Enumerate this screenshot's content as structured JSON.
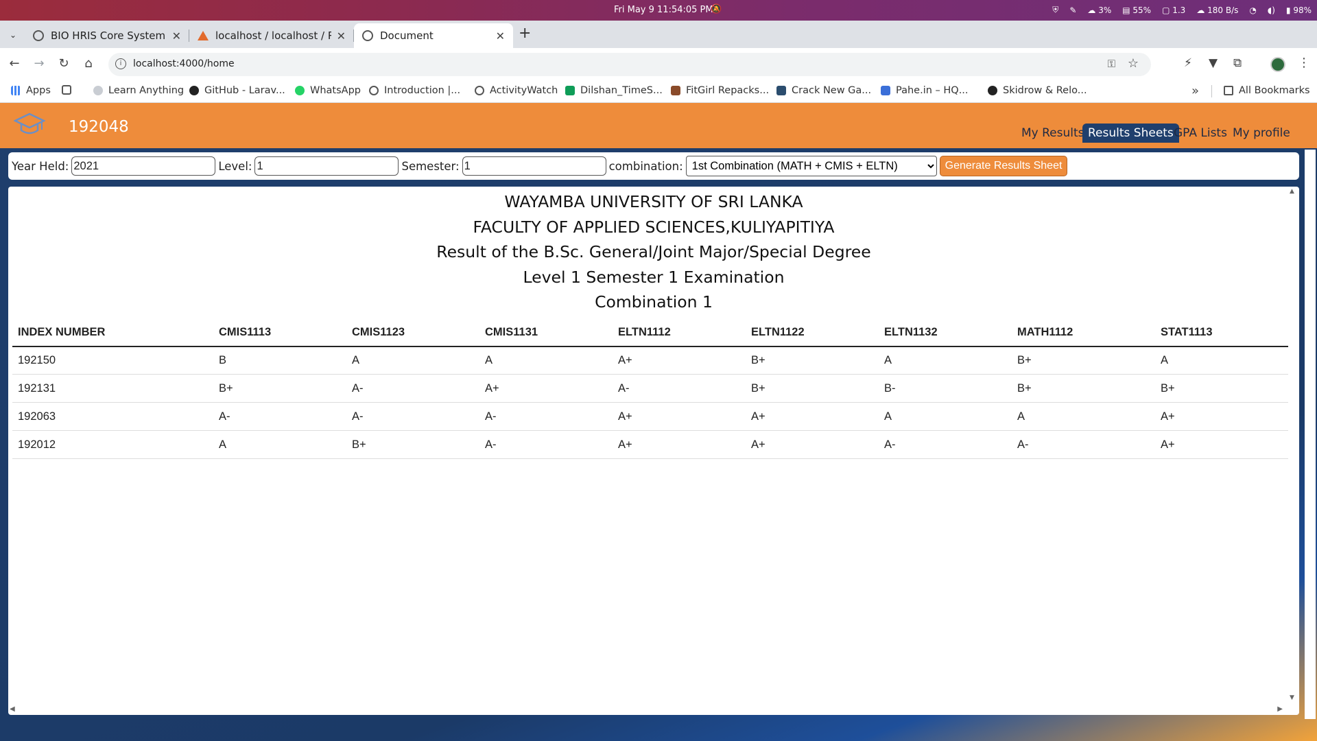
{
  "os": {
    "clock": "Fri May 9  11:54:05 PM",
    "status": [
      "3%",
      "55%",
      "1.3",
      "180 B/s",
      "98%"
    ]
  },
  "tabs": [
    {
      "title": "BIO HRIS Core System"
    },
    {
      "title": "localhost / localhost / RE"
    },
    {
      "title": "Document"
    }
  ],
  "address": {
    "url": "localhost:4000/home"
  },
  "bookmarks": {
    "apps": "Apps",
    "items": [
      "Learn Anything",
      "GitHub - Larav...",
      "WhatsApp",
      "Introduction |...",
      "ActivityWatch",
      "Dilshan_TimeS...",
      "FitGirl Repacks...",
      "Crack New Ga...",
      "Pahe.in – HQ...",
      "Skidrow & Relo..."
    ],
    "all": "All Bookmarks"
  },
  "app": {
    "user_id": "192048",
    "nav": [
      "My Results",
      "Results Sheets",
      "GPA Lists",
      "My profile"
    ],
    "active_nav": "Results Sheets"
  },
  "filters": {
    "year_label": "Year Held:",
    "year_value": "2021",
    "level_label": "Level:",
    "level_value": "1",
    "semester_label": "Semester:",
    "semester_value": "1",
    "combination_label": "combination:",
    "combination_value": "1st Combination (MATH + CMIS + ELTN)",
    "generate_label": "Generate Results Sheet"
  },
  "sheet": {
    "title_lines": [
      "WAYAMBA UNIVERSITY OF SRI LANKA",
      "FACULTY OF APPLIED SCIENCES,KULIYAPITIYA",
      "Result of the B.Sc. General/Joint Major/Special Degree",
      "Level 1 Semester 1 Examination",
      "Combination 1"
    ],
    "columns": [
      "INDEX NUMBER",
      "CMIS1113",
      "CMIS1123",
      "CMIS1131",
      "ELTN1112",
      "ELTN1122",
      "ELTN1132",
      "MATH1112",
      "STAT1113"
    ],
    "rows": [
      [
        "192150",
        "B",
        "A",
        "A",
        "A+",
        "B+",
        "A",
        "B+",
        "A"
      ],
      [
        "192131",
        "B+",
        "A-",
        "A+",
        "A-",
        "B+",
        "B-",
        "B+",
        "B+"
      ],
      [
        "192063",
        "A-",
        "A-",
        "A-",
        "A+",
        "A+",
        "A",
        "A",
        "A+"
      ],
      [
        "192012",
        "A",
        "B+",
        "A-",
        "A+",
        "A+",
        "A-",
        "A-",
        "A+"
      ]
    ]
  }
}
